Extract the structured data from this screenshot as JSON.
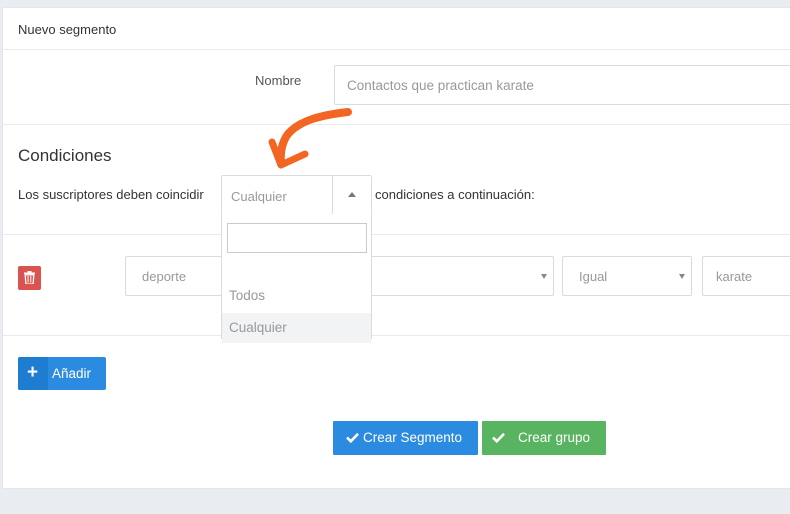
{
  "panel": {
    "title": "Nuevo segmento"
  },
  "name_field": {
    "label": "Nombre",
    "value": "Contactos que practican karate"
  },
  "conditions": {
    "title": "Condiciones",
    "match_prefix": "Los suscriptores deben coincidir",
    "match_suffix": "condiciones a continuación:",
    "match_select": {
      "selected": "Cualquier",
      "options": [
        "Todos",
        "Cualquier"
      ],
      "highlighted": "Cualquier"
    },
    "rows": [
      {
        "field": "deporte",
        "operator": "Igual",
        "value": "karate"
      }
    ]
  },
  "buttons": {
    "add": "Añadir",
    "create_segment": "Crear Segmento",
    "create_group": "Crear grupo"
  },
  "colors": {
    "primary": "#2b8be0",
    "success": "#58b460",
    "danger": "#d9534f",
    "annotation": "#f26522"
  }
}
